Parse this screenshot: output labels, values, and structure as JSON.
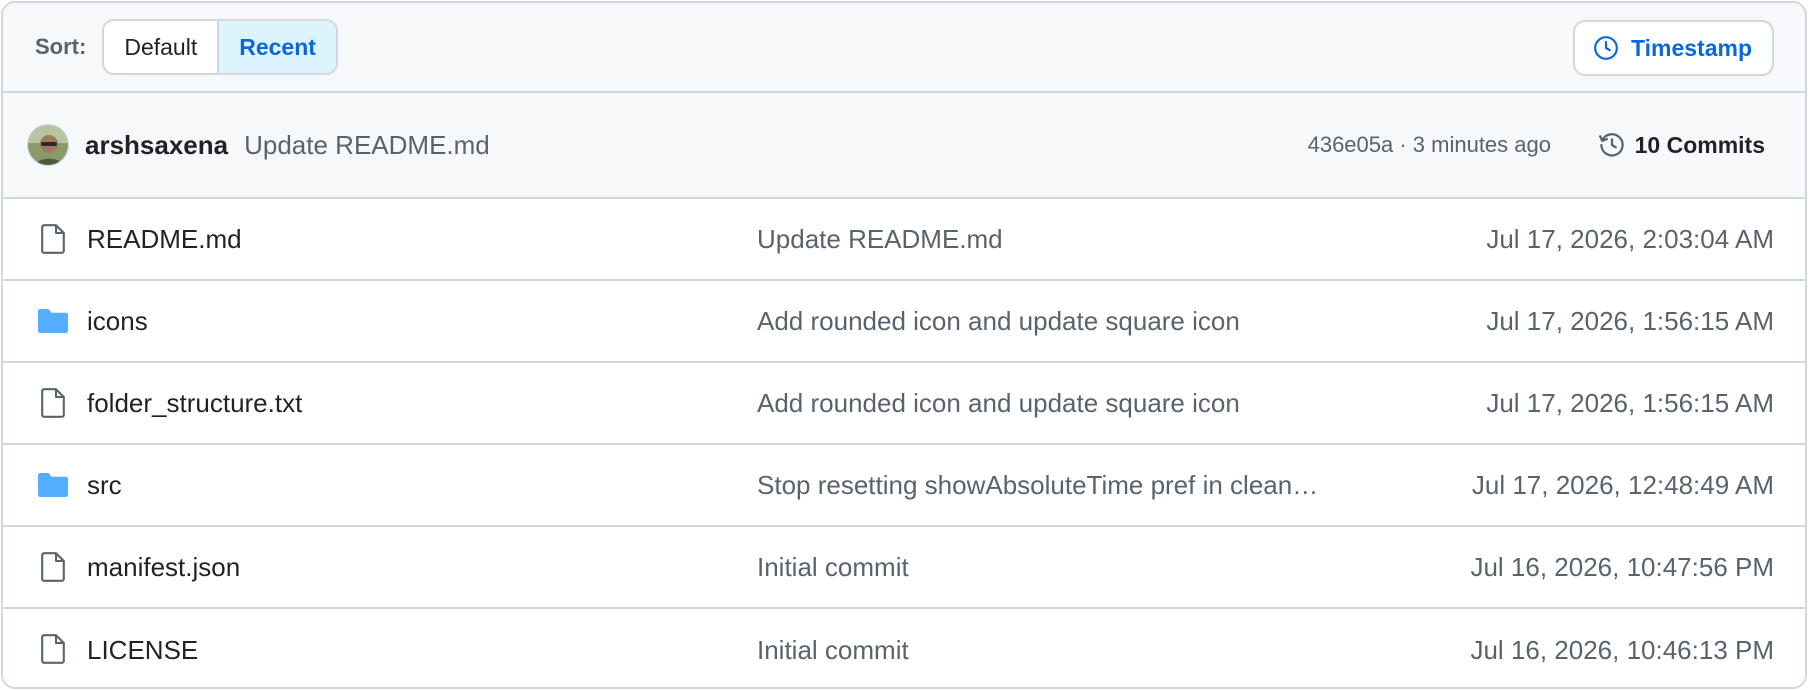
{
  "sort": {
    "label": "Sort:",
    "options": [
      "Default",
      "Recent"
    ],
    "selected": "Recent",
    "timestamp_button": "Timestamp"
  },
  "latest_commit": {
    "author": "arshsaxena",
    "message": "Update README.md",
    "meta": "436e05a · 3 minutes ago",
    "commits_label": "10 Commits"
  },
  "files": [
    {
      "name": "README.md",
      "type": "file",
      "icon": "file-icon",
      "message": "Update README.md",
      "date": "Jul 17, 2026, 2:03:04 AM"
    },
    {
      "name": "icons",
      "type": "folder",
      "icon": "folder-icon",
      "message": "Add rounded icon and update square icon",
      "date": "Jul 17, 2026, 1:56:15 AM"
    },
    {
      "name": "folder_structure.txt",
      "type": "file",
      "icon": "file-icon",
      "message": "Add rounded icon and update square icon",
      "date": "Jul 17, 2026, 1:56:15 AM"
    },
    {
      "name": "src",
      "type": "folder",
      "icon": "folder-icon",
      "message": "Stop resetting showAbsoluteTime pref in clean…",
      "date": "Jul 17, 2026, 12:48:49 AM"
    },
    {
      "name": "manifest.json",
      "type": "file",
      "icon": "file-icon",
      "message": "Initial commit",
      "date": "Jul 16, 2026, 10:47:56 PM"
    },
    {
      "name": "LICENSE",
      "type": "file",
      "icon": "file-icon",
      "message": "Initial commit",
      "date": "Jul 16, 2026, 10:46:13 PM"
    }
  ],
  "colors": {
    "accent": "#0969da",
    "folder": "#54aeff",
    "border": "#d0d7de",
    "muted_text": "#59636e"
  }
}
